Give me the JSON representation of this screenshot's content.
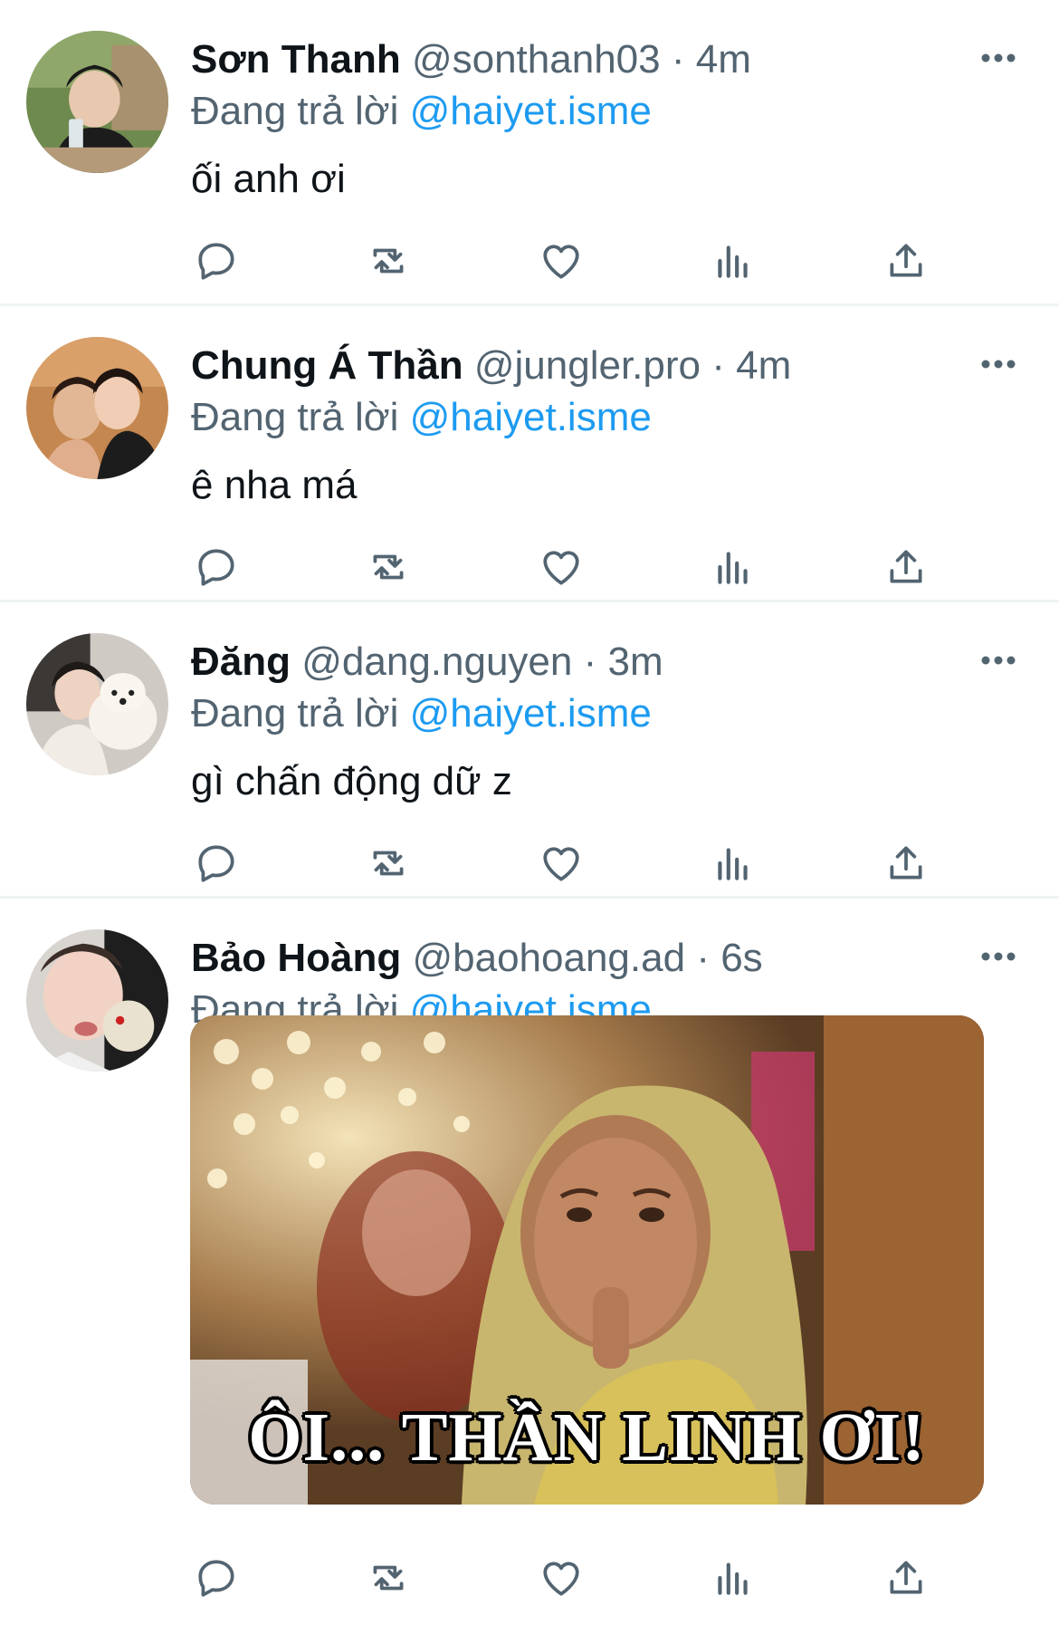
{
  "reply_prefix": "Đang trả lời",
  "tweets": [
    {
      "name": "Sơn Thanh",
      "handle": "@sonthanh03",
      "separator": "·",
      "time": "4m",
      "reply_to": "@haiyet.isme",
      "text": "ối anh ơi"
    },
    {
      "name": "Chung Á Thần",
      "handle": "@jungler.pro",
      "separator": "·",
      "time": "4m",
      "reply_to": "@haiyet.isme",
      "text": "ê nha má"
    },
    {
      "name": "Đăng",
      "handle": "@dang.nguyen",
      "separator": "·",
      "time": "3m",
      "reply_to": "@haiyet.isme",
      "text": "gì chấn động dữ z"
    },
    {
      "name": "Bảo Hoàng",
      "handle": "@baohoang.ad",
      "separator": "·",
      "time": "6s",
      "reply_to": "@haiyet.isme",
      "media_caption": "ÔI... THẦN LINH ƠI!"
    }
  ],
  "icons": {
    "reply": "reply-icon",
    "retweet": "retweet-icon",
    "like": "heart-icon",
    "views": "views-icon",
    "share": "share-icon",
    "more": "more-icon"
  },
  "colors": {
    "text": "#0f1419",
    "secondary": "#536471",
    "link": "#1d9bf0",
    "divider": "#eff3f4"
  }
}
